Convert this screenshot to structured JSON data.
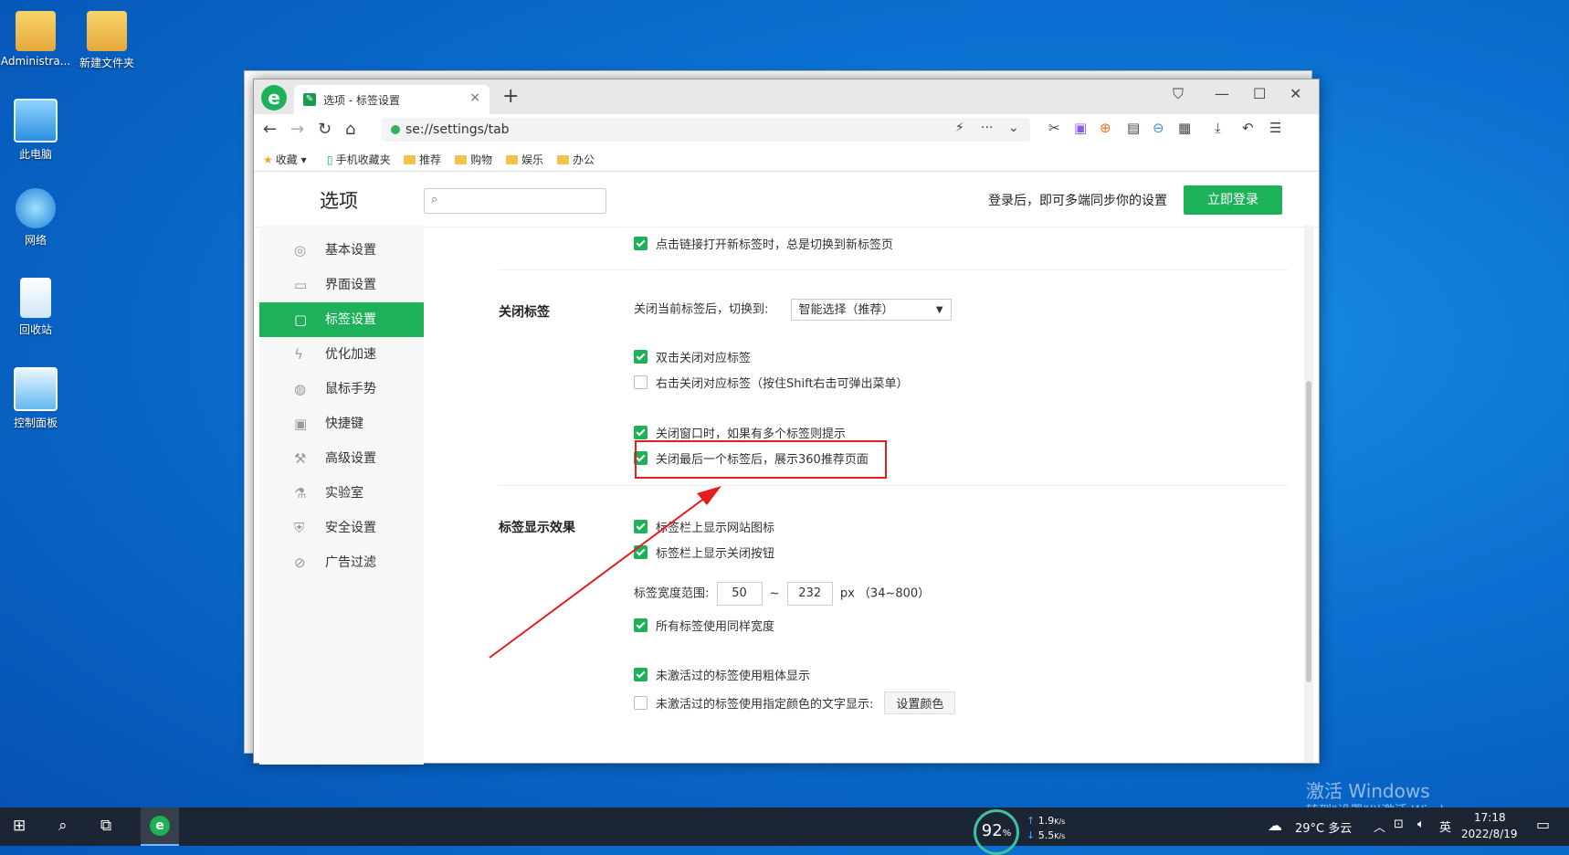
{
  "desktop": {
    "icons": [
      {
        "label": "Administra...",
        "icon": "user-folder-icon"
      },
      {
        "label": "新建文件夹",
        "icon": "folder-icon"
      },
      {
        "label": "此电脑",
        "icon": "computer-icon"
      },
      {
        "label": "网络",
        "icon": "network-icon"
      },
      {
        "label": "回收站",
        "icon": "recycle-bin-icon"
      },
      {
        "label": "控制面板",
        "icon": "control-panel-icon"
      }
    ],
    "watermark_line1": "激活 Windows",
    "watermark_line2": "转到\"设置\"以激活 Windows。"
  },
  "browser": {
    "tab_title": "选项 - 标签设置",
    "tab_close": "×",
    "new_tab": "+",
    "url": "se://settings/tab",
    "bookmarks": [
      {
        "label": "收藏",
        "icon": "star-icon"
      },
      {
        "label": "手机收藏夹",
        "icon": "phone-icon"
      },
      {
        "label": "推荐",
        "icon": "folder-icon"
      },
      {
        "label": "购物",
        "icon": "folder-icon"
      },
      {
        "label": "娱乐",
        "icon": "folder-icon"
      },
      {
        "label": "办公",
        "icon": "folder-icon"
      }
    ]
  },
  "settings": {
    "title": "选项",
    "login_tip": "登录后，即可多端同步你的设置",
    "login_button": "立即登录",
    "nav": [
      {
        "label": "基本设置",
        "icon": "gear-icon",
        "active": false
      },
      {
        "label": "界面设置",
        "icon": "window-icon",
        "active": false
      },
      {
        "label": "标签设置",
        "icon": "tab-icon",
        "active": true
      },
      {
        "label": "优化加速",
        "icon": "lightning-icon",
        "active": false
      },
      {
        "label": "鼠标手势",
        "icon": "mouse-icon",
        "active": false
      },
      {
        "label": "快捷键",
        "icon": "keyboard-icon",
        "active": false
      },
      {
        "label": "高级设置",
        "icon": "wrench-icon",
        "active": false
      },
      {
        "label": "实验室",
        "icon": "flask-icon",
        "active": false
      },
      {
        "label": "安全设置",
        "icon": "shield-icon",
        "active": false
      },
      {
        "label": "广告过滤",
        "icon": "block-icon",
        "active": false
      }
    ],
    "top_option": {
      "label": "点击链接打开新标签时，总是切换到新标签页",
      "checked": true
    },
    "close_tab": {
      "section_label": "关闭标签",
      "switch_label": "关闭当前标签后，切换到:",
      "switch_value": "智能选择（推荐）",
      "options": [
        {
          "label": "双击关闭对应标签",
          "checked": true
        },
        {
          "label": "右击关闭对应标签（按住Shift右击可弹出菜单）",
          "checked": false
        },
        {
          "label": "关闭窗口时，如果有多个标签则提示",
          "checked": true
        },
        {
          "label": "关闭最后一个标签后，展示360推荐页面",
          "checked": true
        }
      ]
    },
    "display": {
      "section_label": "标签显示效果",
      "options": [
        {
          "label": "标签栏上显示网站图标",
          "checked": true
        },
        {
          "label": "标签栏上显示关闭按钮",
          "checked": true
        }
      ],
      "width_label": "标签宽度范围:",
      "width_min": "50",
      "width_sep": "~",
      "width_max": "232",
      "width_unit": "px （34~800）",
      "same_width": {
        "label": "所有标签使用同样宽度",
        "checked": true
      },
      "bold_inactive": {
        "label": "未激活过的标签使用粗体显示",
        "checked": true
      },
      "color_inactive": {
        "label": "未激活过的标签使用指定颜色的文字显示:",
        "checked": false
      },
      "color_button": "设置颜色"
    }
  },
  "taskbar": {
    "cpu_percent": "92",
    "cpu_unit": "%",
    "net_up": "1.9",
    "net_down": "5.5",
    "net_unit": "K/s",
    "weather": "29°C 多云",
    "ime": "英",
    "time": "17:18",
    "date": "2022/8/19"
  },
  "colors": {
    "accent": "#1db25a",
    "highlight": "#e41d1d",
    "taskbar": "#1c2533"
  }
}
